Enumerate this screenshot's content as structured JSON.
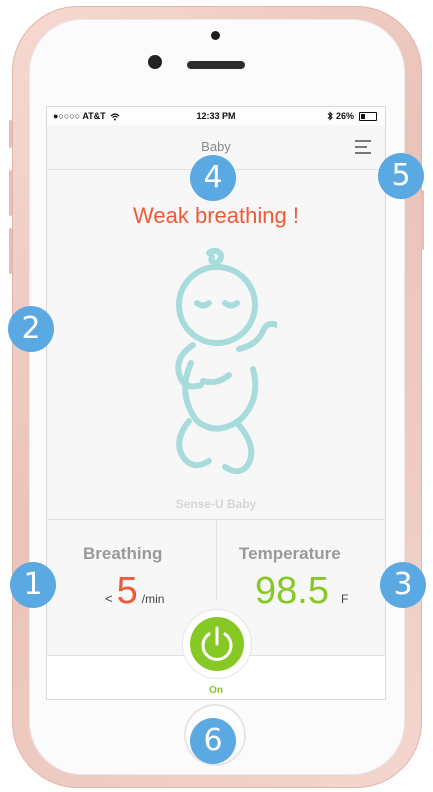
{
  "status_bar": {
    "carrier": "●○○○○ AT&T",
    "time": "12:33 PM",
    "battery": "26%"
  },
  "nav": {
    "title": "Baby"
  },
  "alert": {
    "text": "Weak breathing !"
  },
  "brand": {
    "text": "Sense-U Baby"
  },
  "breathing": {
    "label": "Breathing",
    "prefix": "<",
    "value": "5",
    "unit": "/min"
  },
  "temperature": {
    "label": "Temperature",
    "value": "98.5",
    "unit": "F"
  },
  "power": {
    "label": "On"
  },
  "markers": [
    "1",
    "2",
    "3",
    "4",
    "5",
    "6"
  ],
  "colors": {
    "alert": "#ef5a36",
    "good": "#86c924",
    "marker": "#5aa9e2",
    "baby_outline": "#a8dcdc"
  },
  "icons": [
    "wifi-icon",
    "bluetooth-icon",
    "battery-icon",
    "menu-icon",
    "baby-icon",
    "power-icon"
  ]
}
